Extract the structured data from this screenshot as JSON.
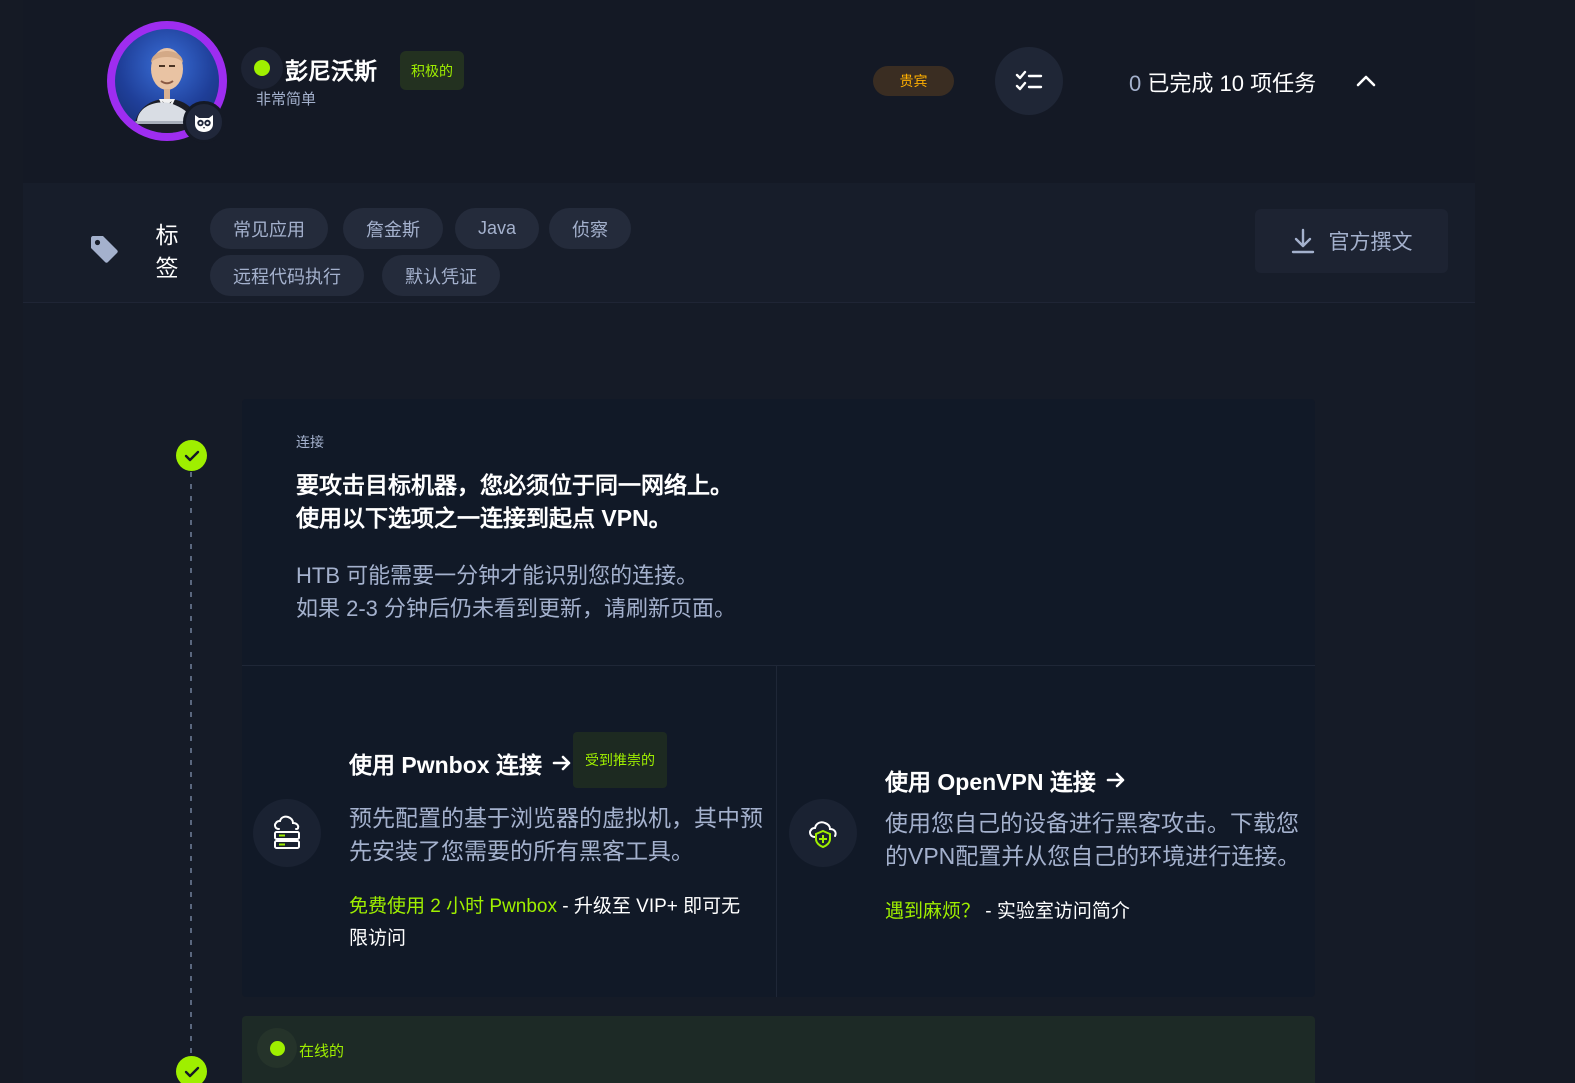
{
  "machine": {
    "name": "彭尼沃斯",
    "difficulty": "非常简单",
    "status": "积极的",
    "vip_label": "贵宾"
  },
  "tasks": {
    "completed": "0",
    "text": "已完成 10 项任务"
  },
  "tags": {
    "label": "标签",
    "items": [
      "常见应用",
      "詹金斯",
      "Java",
      "侦察",
      "远程代码执行",
      "默认凭证"
    ]
  },
  "writeup": {
    "label": "官方撰文"
  },
  "connect": {
    "eyebrow": "连接",
    "title_line1": "要攻击目标机器，您必须位于同一网络上。",
    "title_line2": "使用以下选项之一连接到起点 VPN。",
    "desc_line1": "HTB 可能需要一分钟才能识别您的连接。",
    "desc_line2": "如果 2-3 分钟后仍未看到更新，请刷新页面。",
    "pwnbox": {
      "title": "使用 Pwnbox 连接",
      "badge": "受到推崇的",
      "desc_line1": "预先配置的基于浏览器的虚拟机，其中预",
      "desc_line2": "先安装了您需要的所有黑客工具。",
      "note_green": "免费使用 2 小时 Pwnbox",
      "note_line1": " - 升级至 VIP+ 即可无",
      "note_line2": "限访问"
    },
    "openvpn": {
      "title": "使用 OpenVPN 连接",
      "desc_line1": "使用您自己的设备进行黑客攻击。下载您",
      "desc_line2": "的VPN配置并从您自己的环境进行连接。",
      "note_green": "遇到麻烦？",
      "note_rest": " - 实验室访问简介"
    }
  },
  "online": {
    "label": "在线的"
  },
  "colors": {
    "accent_green": "#9fef00",
    "vip_orange": "#ffaf00",
    "avatar_ring": "#9e2df0",
    "muted_text": "#a4b1cd"
  },
  "icons": [
    "butler-avatar",
    "owl-icon",
    "checklist-icon",
    "chevron-up-icon",
    "tag-icon",
    "download-icon",
    "check-icon",
    "cloud-server-icon",
    "cloud-shield-icon",
    "arrow-right-icon"
  ]
}
